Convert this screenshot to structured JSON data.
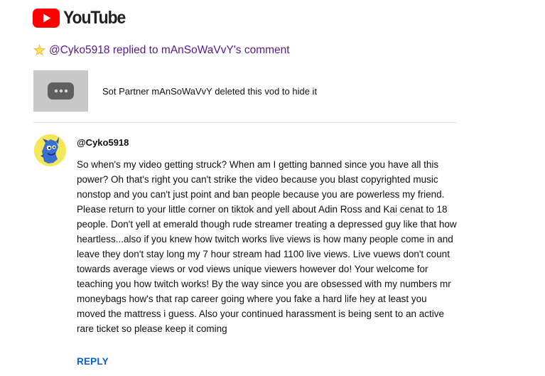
{
  "header": {
    "logo_text": "YouTube",
    "brand_color": "#ff0000"
  },
  "notification": {
    "icon": "sparkle-icon",
    "text": "@Cyko5918 replied to mAnSoWaVvY's comment",
    "link_color": "#551a8b"
  },
  "video": {
    "thumbnail_icon": "more-dots-icon",
    "title": "Sot Partner mAnSoWaVvY deleted this vod to hide it"
  },
  "comment": {
    "author": "@Cyko5918",
    "avatar_icon": "blue-creature-avatar",
    "text": "So when's my video getting struck? When am I getting banned since you have all this power? Oh that's right you can't strike the video because you blast copyrighted music nonstop and you can't just point and ban people because you are powerless my friend. Please return to your little corner on tiktok and yell about Adin Ross and Kai cenat to 18 people. Don't yell at emerald though rude streamer treating a depressed guy like that how heartless...also if you knew how twitch works live views is how many people come in and leave they don't stay long my 7 hour stream had 1100 live views. Live vuews don't count towards average views or vod views unique viewers however do! Your welcome for teaching you how twitch works! By the way since you are obsessed with my numbers mr moneybags how's that rap career going where you fake a hard life hey at least you moved the mattress i guess. Also your continued harassment is being sent to an active rare ticket so please keep it coming",
    "reply_label": "REPLY",
    "reply_color": "#065fd4"
  }
}
